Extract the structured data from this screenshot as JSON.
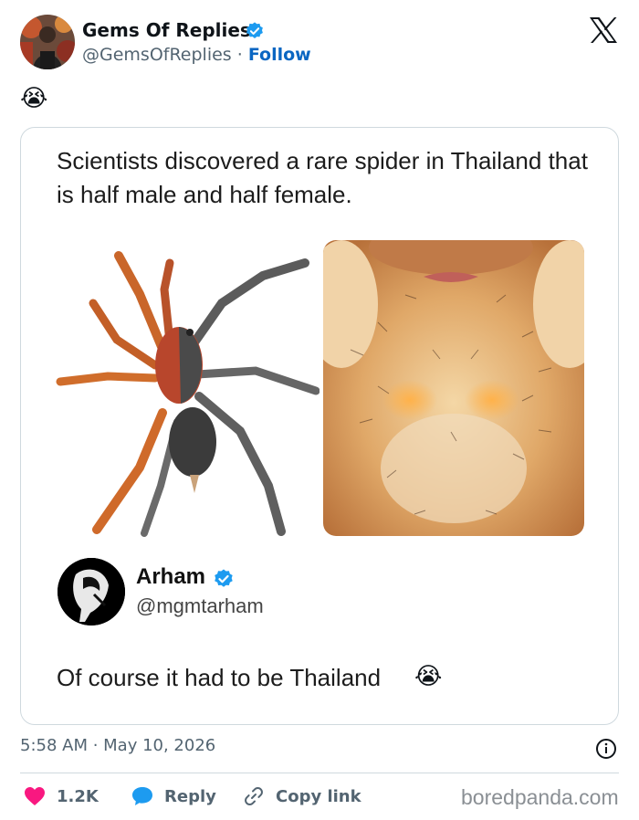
{
  "author": {
    "name": "Gems Of Replies",
    "handle": "@GemsOfReplies",
    "separator": " · ",
    "follow_label": "Follow"
  },
  "tweet": {
    "emoji": "😭"
  },
  "quoted_post": {
    "text": "Scientists discovered a rare spider in Thailand that is half male and half female.",
    "reply": {
      "name": "Arham",
      "handle": "@mgmtarham",
      "text": "Of course it had to be Thailand",
      "emoji": "😭"
    }
  },
  "meta": {
    "timestamp": "5:58 AM · May 10, 2026"
  },
  "actions": {
    "like_count": "1.2K",
    "reply_label": "Reply",
    "copy_link_label": "Copy link"
  },
  "watermark": "boredpanda.com",
  "colors": {
    "link_blue": "#0a66c2",
    "verified_blue": "#1d9bf0",
    "like_red": "#f91880",
    "muted_text": "#536471",
    "border": "#cfd9de"
  },
  "icons": [
    "verified-badge-icon",
    "x-logo-icon",
    "info-icon",
    "heart-icon",
    "reply-bubble-icon",
    "link-icon"
  ]
}
